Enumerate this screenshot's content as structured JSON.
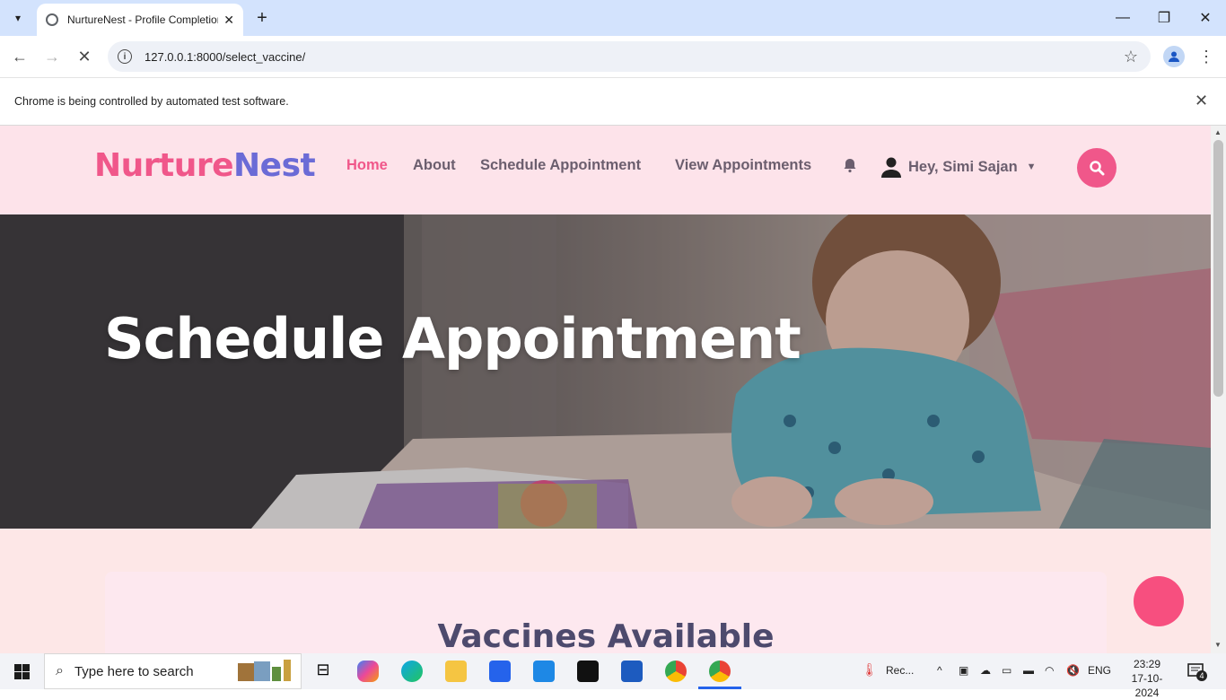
{
  "browser": {
    "tab_title": "NurtureNest - Profile Completion",
    "url": "127.0.0.1:8000/select_vaccine/",
    "infobar_message": "Chrome is being controlled by automated test software."
  },
  "site": {
    "logo_part1": "Nurture",
    "logo_part2": "Nest",
    "nav": [
      {
        "label": "Home",
        "active": true
      },
      {
        "label": "About",
        "active": false
      },
      {
        "label": "Schedule Appointment",
        "active": false
      },
      {
        "label": "View Appointments",
        "active": false
      }
    ],
    "user_greeting": "Hey, Simi Sajan",
    "hero_title": "Schedule Appointment",
    "card_title": "Vaccines Available",
    "colors": {
      "brand_pink": "#f0578a",
      "brand_purple": "#6b6bd6",
      "nav_bg": "#fde3ea",
      "heading": "#4d4a6d"
    }
  },
  "taskbar": {
    "search_placeholder": "Type here to search",
    "tray_app": "Rec...",
    "language": "ENG",
    "time": "23:29",
    "date": "17-10-2024",
    "notifications": "4"
  }
}
